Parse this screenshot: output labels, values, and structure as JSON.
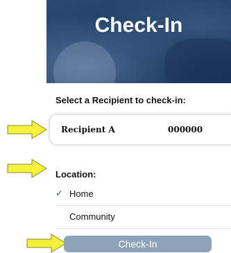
{
  "header": {
    "title": "Check-In"
  },
  "recipient": {
    "prompt": "Select a Recipient to check-in:",
    "name": "Recipient A",
    "id": "000000"
  },
  "location": {
    "label": "Location:",
    "options": [
      {
        "label": "Home",
        "selected": true
      },
      {
        "label": "Community",
        "selected": false
      }
    ],
    "check_glyph": "✓"
  },
  "actions": {
    "checkin_label": "Check-In"
  },
  "colors": {
    "arrow_fill": "#f5f03c",
    "arrow_stroke": "#8a8a2a",
    "button_bg": "#8fa3b8",
    "hero_bg": "#1d3b63"
  }
}
